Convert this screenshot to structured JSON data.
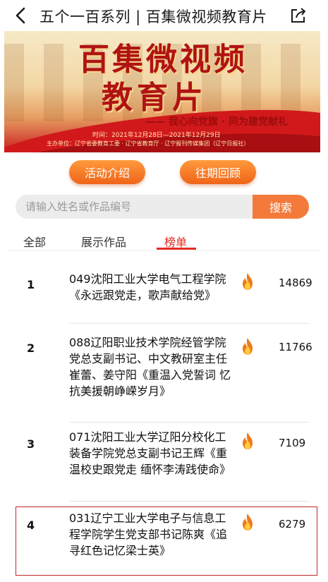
{
  "header": {
    "title": "五个一百系列 | 百集微视频教育片"
  },
  "banner": {
    "title_line1": "百集微视频",
    "title_line2": "教育片",
    "slogan": "—— 我心向党旗 · 同为建党献礼",
    "time": "时间：2021年12月28日—2021年12月29日",
    "organizer": "主办单位：辽宁省委教育工委 · 辽宁省教育厅 · 辽宁报刊传媒集团（辽宁日报社）"
  },
  "buttons": {
    "intro": "活动介绍",
    "review": "往期回顾"
  },
  "search": {
    "placeholder": "请输入姓名或作品编号",
    "button": "搜索"
  },
  "tabs": [
    {
      "label": "全部"
    },
    {
      "label": "展示作品"
    },
    {
      "label": "榜单",
      "active": true
    }
  ],
  "ranking": [
    {
      "rank": "1",
      "title": "049沈阳工业大学电气工程学院《永远跟党走，歌声献给党》",
      "score": "14869"
    },
    {
      "rank": "2",
      "title": "088辽阳职业技术学院经管学院党总支副书记、中文教研室主任崔蕾、姜守阳《重温入党誓词 忆抗美援朝峥嵘岁月》",
      "score": "11766"
    },
    {
      "rank": "3",
      "title": "071沈阳工业大学辽阳分校化工装备学院党总支副书记王辉《重温校史跟党走 缅怀李涛践使命》",
      "score": "7109"
    },
    {
      "rank": "4",
      "title": "031辽宁工业大学电子与信息工程学院学生党支部书记陈爽《追寻红色记忆梁士英》",
      "score": "6279"
    }
  ],
  "colors": {
    "accent": "#f47a3c",
    "active_tab": "#e52a1c",
    "highlight_border": "#c0262b"
  },
  "icons": {
    "back": "chevron-left-icon",
    "share": "share-icon",
    "fire": "fire-icon"
  }
}
